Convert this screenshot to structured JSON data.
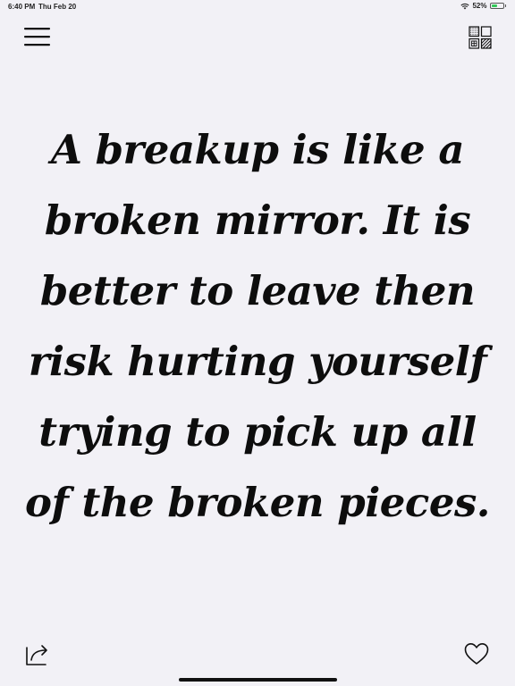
{
  "status_bar": {
    "time": "6:40 PM",
    "date": "Thu Feb 20",
    "battery_percent": "52%",
    "battery_level": 0.52,
    "icons": [
      "wifi-icon",
      "battery-icon"
    ],
    "battery_color": "#34c759"
  },
  "toolbar": {
    "menu_icon": "hamburger-menu-icon",
    "apps_icon": "grid-apps-icon"
  },
  "quote": {
    "lines": [
      "A breakup is like a",
      "broken mirror. It is",
      "better to leave then",
      "risk hurting yourself",
      "trying to pick up all",
      "of the broken pieces."
    ]
  },
  "bottom_bar": {
    "share_icon": "share-icon",
    "favorite_icon": "heart-icon"
  },
  "colors": {
    "background": "#f2f1f6",
    "text": "#0d0d0d"
  }
}
